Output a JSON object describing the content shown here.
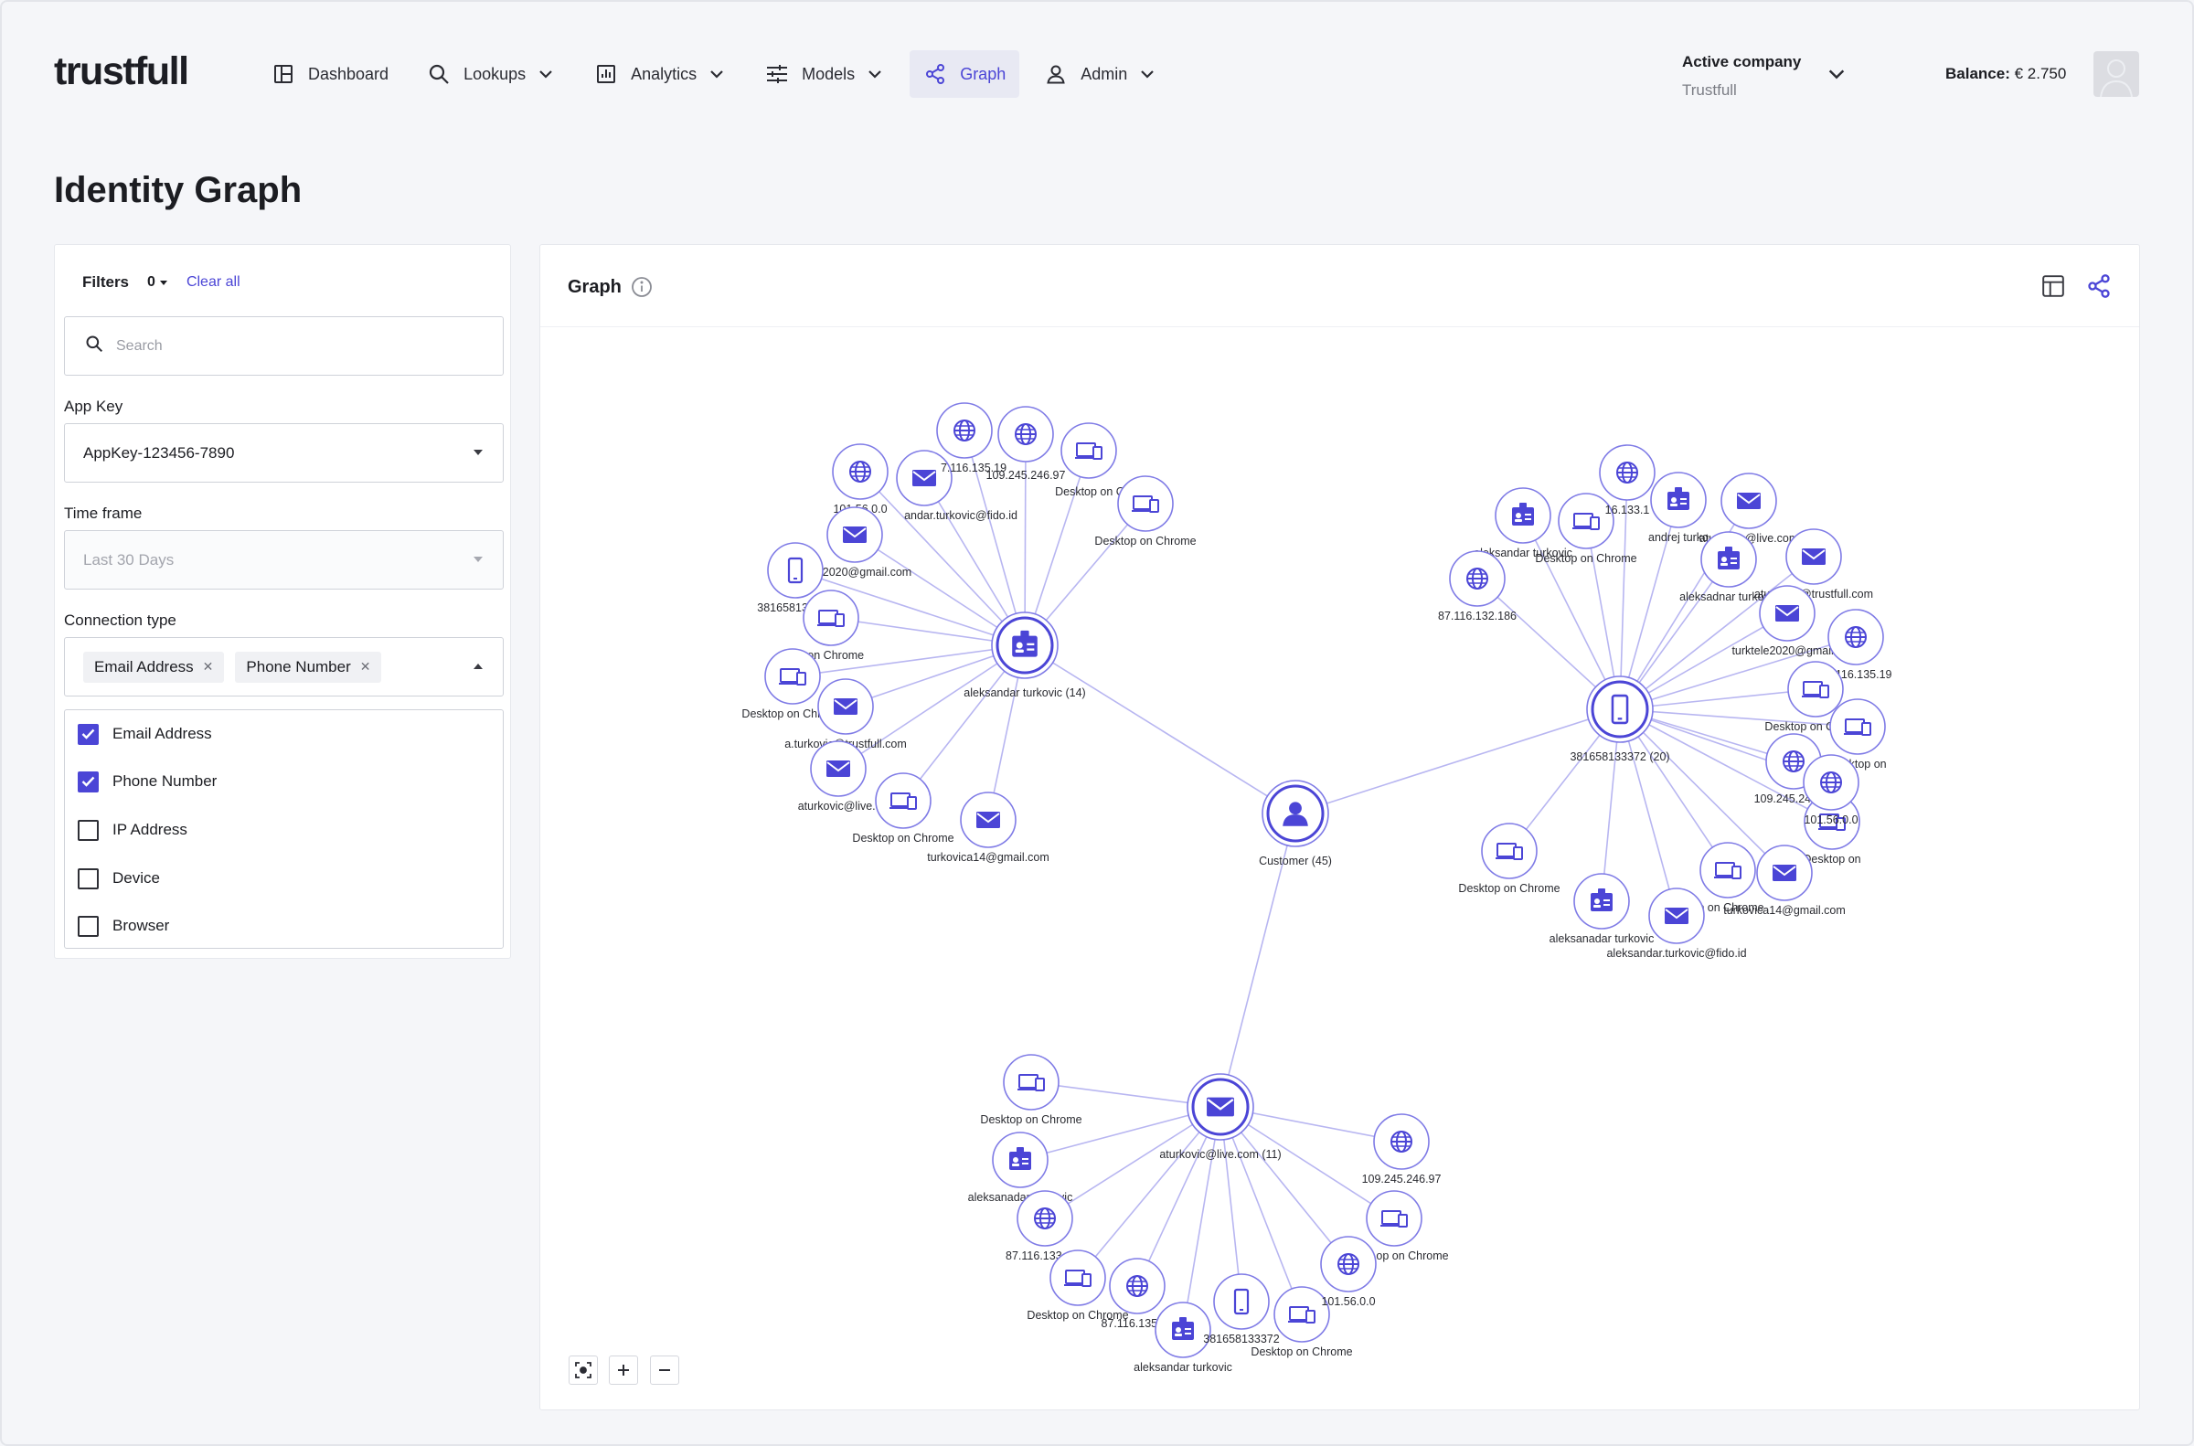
{
  "app": {
    "logo": "trustfull"
  },
  "nav": {
    "items": [
      {
        "label": "Dashboard",
        "icon": "dashboard-icon",
        "dropdown": false,
        "active": false
      },
      {
        "label": "Lookups",
        "icon": "search-icon",
        "dropdown": true,
        "active": false
      },
      {
        "label": "Analytics",
        "icon": "analytics-icon",
        "dropdown": true,
        "active": false
      },
      {
        "label": "Models",
        "icon": "sliders-icon",
        "dropdown": true,
        "active": false
      },
      {
        "label": "Graph",
        "icon": "share-graph-icon",
        "dropdown": false,
        "active": true
      },
      {
        "label": "Admin",
        "icon": "user-icon",
        "dropdown": true,
        "active": false
      }
    ]
  },
  "company": {
    "label": "Active company",
    "value": "Trustfull"
  },
  "balance": {
    "label": "Balance:",
    "value": "€ 2.750"
  },
  "page": {
    "title": "Identity Graph"
  },
  "filters": {
    "title": "Filters",
    "count": "0",
    "clear_label": "Clear all",
    "search_placeholder": "Search",
    "app_key": {
      "label": "App Key",
      "value": "AppKey-123456-7890"
    },
    "time_frame": {
      "label": "Time frame",
      "value": "Last 30 Days"
    },
    "connection_type": {
      "label": "Connection type",
      "selected": [
        "Email Address",
        "Phone Number"
      ],
      "options": [
        {
          "label": "Email Address",
          "checked": true
        },
        {
          "label": "Phone Number",
          "checked": true
        },
        {
          "label": "IP Address",
          "checked": false
        },
        {
          "label": "Device",
          "checked": false
        },
        {
          "label": "Browser",
          "checked": false
        }
      ]
    }
  },
  "graph_panel": {
    "title": "Graph"
  },
  "colors": {
    "accent": "#4b45d6",
    "edge": "#b8b6f1",
    "node_border": "#7f7be6"
  },
  "graph": {
    "hubs": [
      {
        "id": "h0",
        "type": "person",
        "label": "Customer (45)"
      },
      {
        "id": "h1",
        "type": "id",
        "label": "aleksandar turkovic (14)"
      },
      {
        "id": "h2",
        "type": "phone",
        "label": "381658133372 (20)"
      },
      {
        "id": "h3",
        "type": "email",
        "label": "aturkovic@live.com (11)"
      }
    ],
    "edges": [
      [
        "h0",
        "h1"
      ],
      [
        "h0",
        "h2"
      ],
      [
        "h0",
        "h3"
      ]
    ],
    "leaves": [
      {
        "hub": "h1",
        "type": "ip",
        "label": "101.56.0.0"
      },
      {
        "hub": "h1",
        "type": "email",
        "label": "andar.turkovic@fido.id"
      },
      {
        "hub": "h1",
        "type": "ip",
        "label": "7.116.135.19"
      },
      {
        "hub": "h1",
        "type": "ip",
        "label": "109.245.246.97"
      },
      {
        "hub": "h1",
        "type": "device",
        "label": "Desktop on Chro"
      },
      {
        "hub": "h1",
        "type": "device",
        "label": "Desktop on Chrome"
      },
      {
        "hub": "h1",
        "type": "email",
        "label": "e2020@gmail.com"
      },
      {
        "hub": "h1",
        "type": "phone",
        "label": "381658133372"
      },
      {
        "hub": "h1",
        "type": "device",
        "label": "p on Chrome"
      },
      {
        "hub": "h1",
        "type": "device",
        "label": "Desktop on Chrome"
      },
      {
        "hub": "h1",
        "type": "email",
        "label": "a.turkovic@trustfull.com"
      },
      {
        "hub": "h1",
        "type": "email",
        "label": "aturkovic@live.com"
      },
      {
        "hub": "h1",
        "type": "device",
        "label": "Desktop on Chrome"
      },
      {
        "hub": "h1",
        "type": "email",
        "label": "turkovica14@gmail.com"
      },
      {
        "hub": "h2",
        "type": "id",
        "label": "aleksandar turkovic"
      },
      {
        "hub": "h2",
        "type": "device",
        "label": "Desktop on Chrome"
      },
      {
        "hub": "h2",
        "type": "ip",
        "label": "16.133.1"
      },
      {
        "hub": "h2",
        "type": "id",
        "label": "andrej turko"
      },
      {
        "hub": "h2",
        "type": "email",
        "label": "aturkovic@live.com"
      },
      {
        "hub": "h2",
        "type": "ip",
        "label": "87.116.132.186"
      },
      {
        "hub": "h2",
        "type": "id",
        "label": "aleksadnar turkovic"
      },
      {
        "hub": "h2",
        "type": "email",
        "label": "aturkovic@trustfull.com"
      },
      {
        "hub": "h2",
        "type": "email",
        "label": "turktele2020@gmail.c"
      },
      {
        "hub": "h2",
        "type": "ip",
        "label": "87.116.135.19"
      },
      {
        "hub": "h2",
        "type": "device",
        "label": "Desktop on Chrome"
      },
      {
        "hub": "h2",
        "type": "device",
        "label": "Desktop on"
      },
      {
        "hub": "h2",
        "type": "ip",
        "label": "109.245.246.97"
      },
      {
        "hub": "h2",
        "type": "device",
        "label": "Desktop on"
      },
      {
        "hub": "h2",
        "type": "ip",
        "label": "101.56.0.0"
      },
      {
        "hub": "h2",
        "type": "device",
        "label": "Desktop on Chrome"
      },
      {
        "hub": "h2",
        "type": "email",
        "label": "turkovica14@gmail.com"
      },
      {
        "hub": "h2",
        "type": "device",
        "label": "op on Chrome"
      },
      {
        "hub": "h2",
        "type": "id",
        "label": "aleksanadar turkovic"
      },
      {
        "hub": "h2",
        "type": "email",
        "label": "aleksandar.turkovic@fido.id"
      },
      {
        "hub": "h3",
        "type": "device",
        "label": "Desktop on Chrome"
      },
      {
        "hub": "h3",
        "type": "id",
        "label": "aleksanadar turkovic"
      },
      {
        "hub": "h3",
        "type": "ip",
        "label": "87.116.133.163"
      },
      {
        "hub": "h3",
        "type": "device",
        "label": "Desktop on Chrome"
      },
      {
        "hub": "h3",
        "type": "ip",
        "label": "87.116.135.19"
      },
      {
        "hub": "h3",
        "type": "id",
        "label": "aleksandar turkovic"
      },
      {
        "hub": "h3",
        "type": "phone",
        "label": "381658133372"
      },
      {
        "hub": "h3",
        "type": "device",
        "label": "Desktop on Chrome"
      },
      {
        "hub": "h3",
        "type": "ip",
        "label": "101.56.0.0"
      },
      {
        "hub": "h3",
        "type": "device",
        "label": "op on Chrome"
      },
      {
        "hub": "h3",
        "type": "ip",
        "label": "109.245.246.97"
      }
    ]
  }
}
